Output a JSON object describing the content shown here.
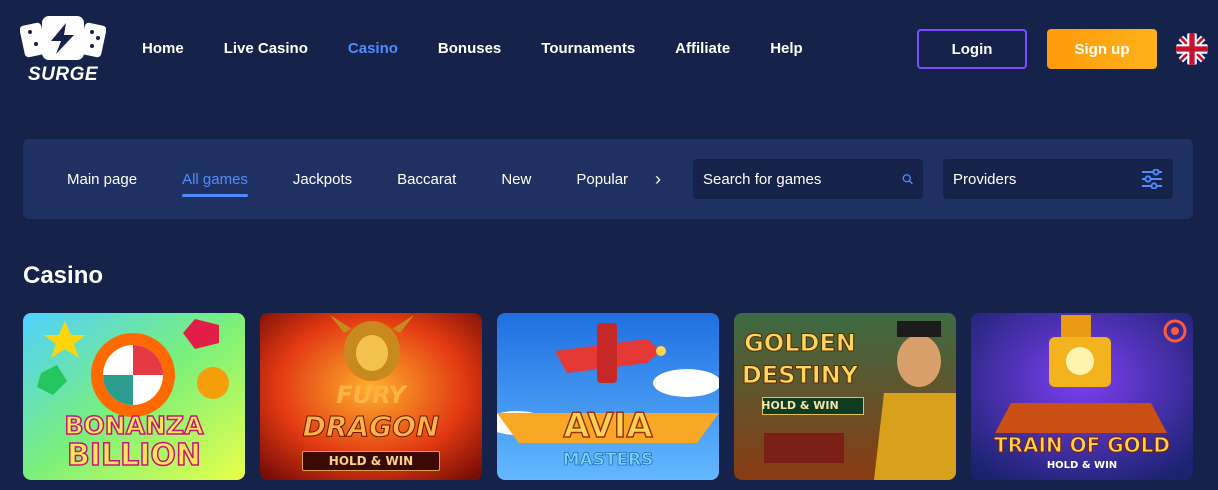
{
  "brand": {
    "name": "SURGE"
  },
  "nav": {
    "items": [
      {
        "label": "Home",
        "active": false
      },
      {
        "label": "Live Casino",
        "active": false
      },
      {
        "label": "Casino",
        "active": true
      },
      {
        "label": "Bonuses",
        "active": false
      },
      {
        "label": "Tournaments",
        "active": false
      },
      {
        "label": "Affiliate",
        "active": false
      },
      {
        "label": "Help",
        "active": false
      }
    ]
  },
  "auth": {
    "login_label": "Login",
    "signup_label": "Sign up"
  },
  "language": {
    "icon": "uk-flag-icon"
  },
  "filters": {
    "tabs": [
      {
        "label": "Main page",
        "active": false
      },
      {
        "label": "All games",
        "active": true
      },
      {
        "label": "Jackpots",
        "active": false
      },
      {
        "label": "Baccarat",
        "active": false
      },
      {
        "label": "New",
        "active": false
      },
      {
        "label": "Popular",
        "active": false
      }
    ],
    "next_icon": "chevron-right-icon",
    "search": {
      "placeholder": "Search for games",
      "value": "",
      "icon": "search-icon"
    },
    "providers": {
      "label": "Providers",
      "icon": "sliders-icon"
    }
  },
  "section": {
    "title": "Casino"
  },
  "games": [
    {
      "line1": "BONANZA",
      "line2": "BILLION",
      "badge": ""
    },
    {
      "line1": "FURY",
      "line2": "DRAGON",
      "badge": "HOLD & WIN"
    },
    {
      "line1": "AVIA",
      "line2": "MASTERS",
      "badge": ""
    },
    {
      "line1": "GOLDEN",
      "line2": "DESTINY",
      "badge": "HOLD & WIN"
    },
    {
      "line1": "TRAIN OF GOLD",
      "line2": "",
      "badge": "HOLD & WIN"
    }
  ],
  "colors": {
    "background": "#15224a",
    "panel": "#1f3163",
    "accent": "#4f8bff",
    "login_border": "#7b4dff",
    "signup": "#ff9a0a"
  }
}
